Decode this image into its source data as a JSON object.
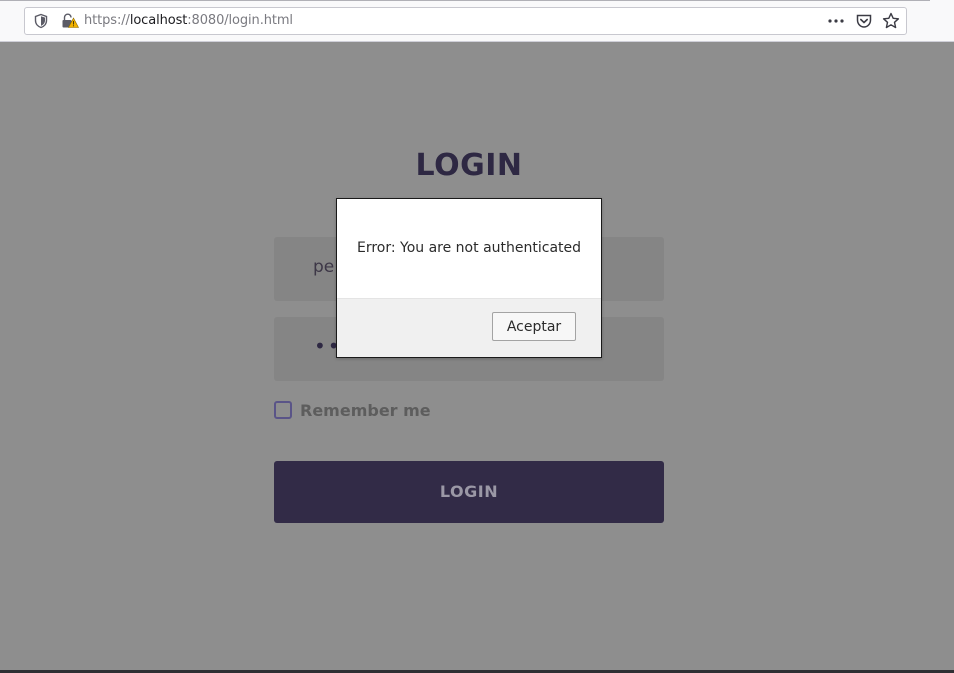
{
  "browser": {
    "url_prefix": "https://",
    "url_host": "localhost",
    "url_suffix": ":8080/login.html",
    "icons": [
      "shield-icon",
      "insecure-lock-icon",
      "more-icon",
      "pocket-icon",
      "star-icon"
    ]
  },
  "login": {
    "title": "LOGIN",
    "username_value": "pe",
    "password_value": "••",
    "remember_label": "Remember me",
    "remember_checked": false,
    "submit_label": "LOGIN"
  },
  "dialog": {
    "message": "Error: You are not authenticated",
    "accept_label": "Aceptar"
  },
  "colors": {
    "overlay_bg": "#8e8e8e",
    "title": "#2e2843",
    "button_bg": "#322b47",
    "checkbox_border": "#5a5488"
  }
}
